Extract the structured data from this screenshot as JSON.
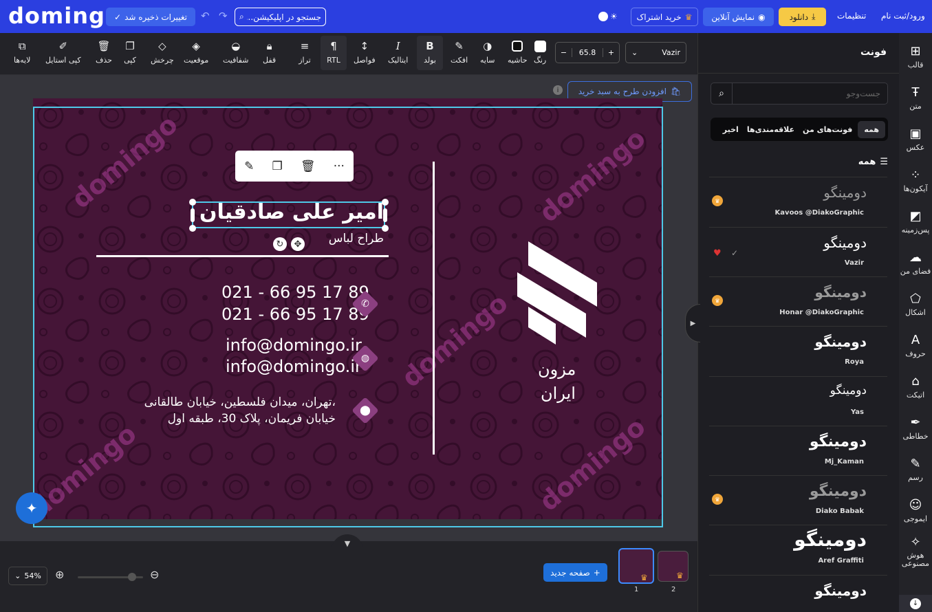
{
  "app": {
    "logo": "domingo"
  },
  "topbar": {
    "save_status": "تغییرات ذخیره شد",
    "search_placeholder": "جستجو در اپلیکیشن...",
    "subscribe_label": "خرید اشتراک",
    "preview_label": "نمایش آنلاین",
    "download_label": "دانلود",
    "settings_label": "تنظیمات",
    "login_label": "ورود/ثبت نام"
  },
  "toolbar": {
    "font_family": "Vazir",
    "font_size": "65.8",
    "tools": [
      {
        "label": "رنگ",
        "icon": "color-swatch-icon"
      },
      {
        "label": "حاشیه",
        "icon": "border-icon"
      },
      {
        "label": "سایه",
        "icon": "shadow-icon"
      },
      {
        "label": "افکت",
        "icon": "effect-wand-icon"
      },
      {
        "label": "بولد",
        "icon": "bold-icon"
      },
      {
        "label": "ایتالیک",
        "icon": "italic-icon"
      },
      {
        "label": "فواصل",
        "icon": "spacing-icon"
      },
      {
        "label": "RTL",
        "icon": "rtl-icon"
      },
      {
        "label": "تراز",
        "icon": "align-icon"
      },
      {
        "label": "قفل",
        "icon": "lock-icon"
      },
      {
        "label": "شفافیت",
        "icon": "opacity-icon"
      },
      {
        "label": "موقعیت",
        "icon": "layers-position-icon"
      },
      {
        "label": "چرخش",
        "icon": "rotate-icon"
      },
      {
        "label": "کپی",
        "icon": "copy-icon"
      },
      {
        "label": "حذف",
        "icon": "trash-icon"
      },
      {
        "label": "کپی استایل",
        "icon": "brush-icon"
      },
      {
        "label": "لایه‌ها",
        "icon": "layers-icon"
      }
    ]
  },
  "canvas": {
    "add_to_cart": "افزودن طرح به سبد خرید",
    "card": {
      "name": "امیر علی صادقیان",
      "title": "طراح لباس",
      "phone1": "021 - 66 95 17 89",
      "phone2": "021 - 66 95 17 89",
      "email1": "info@domingo.ir",
      "email2": "info@domingo.ir",
      "address_line1": "تهران، میدان فلسطین، خیابان طالقانی،",
      "address_line2": "خیابان فریمان، پلاک 30، طبقه اول",
      "brand_line1": "مزون",
      "brand_line2": "ایران",
      "watermark": "domingo"
    }
  },
  "bottombar": {
    "zoom": "54%",
    "zoom_slider_percent": 54,
    "new_page": "صفحه جدید",
    "pages": [
      "1",
      "2"
    ]
  },
  "panel": {
    "title": "فونت",
    "search_placeholder": "جست‌وجو",
    "tabs": [
      "همه",
      "فونت‌های من",
      "علاقه‌مندی‌ها",
      "اخیر"
    ],
    "section_title": "همه",
    "fonts": [
      {
        "preview": "دومینگو",
        "name": "Kavoos @DiakoGraphic",
        "premium": true
      },
      {
        "preview": "دومینگو",
        "name": "Vazir",
        "premium": false,
        "selected": true
      },
      {
        "preview": "دومینگو",
        "name": "Honar @DiakoGraphic",
        "premium": true
      },
      {
        "preview": "دومینگو",
        "name": "Roya",
        "premium": false
      },
      {
        "preview": "دومینگو",
        "name": "Yas",
        "premium": false
      },
      {
        "preview": "دومینگو",
        "name": "Mj_Kaman",
        "premium": false
      },
      {
        "preview": "دومینگو",
        "name": "Diako Babak",
        "premium": true
      },
      {
        "preview": "دومینگو",
        "name": "Aref Graffiti",
        "premium": false
      },
      {
        "preview": "دومینگو",
        "name": "",
        "premium": false
      }
    ]
  },
  "rail": [
    {
      "label": "قالب",
      "icon": "template-icon"
    },
    {
      "label": "متن",
      "icon": "text-icon"
    },
    {
      "label": "عکس",
      "icon": "photo-icon"
    },
    {
      "label": "آیکون‌ها",
      "icon": "icons-grid-icon"
    },
    {
      "label": "پس‌زمینه",
      "icon": "background-icon"
    },
    {
      "label": "فضای من",
      "icon": "upload-cloud-icon"
    },
    {
      "label": "اشکال",
      "icon": "shapes-icon"
    },
    {
      "label": "حروف",
      "icon": "letters-icon"
    },
    {
      "label": "اتیکت",
      "icon": "tag-icon"
    },
    {
      "label": "خطاطی",
      "icon": "feather-icon"
    },
    {
      "label": "رسم",
      "icon": "pencil-icon"
    },
    {
      "label": "ایموجی",
      "icon": "emoji-icon"
    },
    {
      "label": "هوش مصنوعی",
      "icon": "ai-wand-icon"
    }
  ],
  "colors": {
    "brand": "#2b3fe0",
    "accent": "#1e6fd9",
    "card_bg": "#4a1d3d",
    "premium": "#f0a63a"
  }
}
